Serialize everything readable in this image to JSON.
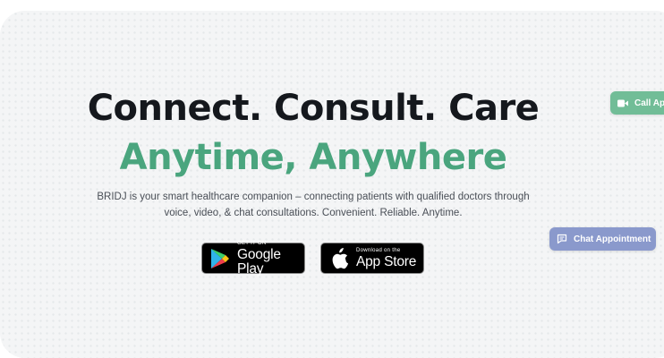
{
  "hero": {
    "headline_line1": "Connect. Consult. Care",
    "headline_line2": "Anytime, Anywhere",
    "description": "BRIDJ is your smart healthcare companion – connecting patients with qualified doctors through voice, video, & chat consultations. Convenient. Reliable. Anytime."
  },
  "store_buttons": {
    "google_play": {
      "small": "GET IT ON",
      "big": "Google Play",
      "icon": "google-play-icon"
    },
    "app_store": {
      "small": "Download on the",
      "big": "App Store",
      "icon": "apple-icon"
    }
  },
  "floating_actions": {
    "call": {
      "label": "Call Ap",
      "icon": "video-camera-icon"
    },
    "chat": {
      "label": "Chat Appointment",
      "icon": "chat-bubble-icon"
    }
  },
  "colors": {
    "headline_dark": "#15181d",
    "accent_green": "#4aa57e",
    "call_button": "#71bd97",
    "chat_button": "#8a99cc"
  }
}
